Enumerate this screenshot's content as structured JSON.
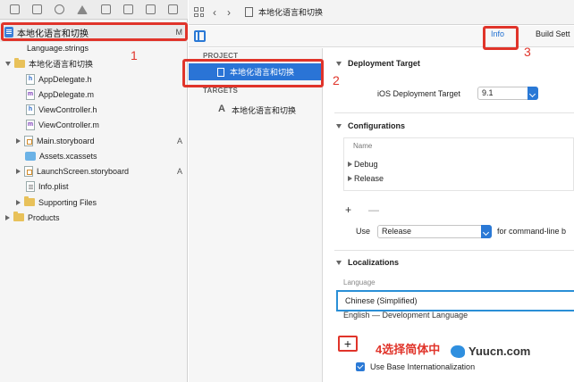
{
  "navigator": {
    "root": {
      "label": "本地化语言和切换",
      "badge": "M"
    },
    "items": [
      {
        "label": "Language.strings",
        "badge": "",
        "kind": "strings"
      },
      {
        "label": "本地化语言和切换",
        "badge": "",
        "kind": "folder-open"
      },
      {
        "label": "AppDelegate.h",
        "badge": "",
        "kind": "header"
      },
      {
        "label": "AppDelegate.m",
        "badge": "",
        "kind": "impl"
      },
      {
        "label": "ViewController.h",
        "badge": "",
        "kind": "header"
      },
      {
        "label": "ViewController.m",
        "badge": "",
        "kind": "impl"
      },
      {
        "label": "Main.storyboard",
        "badge": "A",
        "kind": "storyboard"
      },
      {
        "label": "Assets.xcassets",
        "badge": "",
        "kind": "assets"
      },
      {
        "label": "LaunchScreen.storyboard",
        "badge": "A",
        "kind": "storyboard"
      },
      {
        "label": "Info.plist",
        "badge": "",
        "kind": "plist"
      },
      {
        "label": "Supporting Files",
        "badge": "",
        "kind": "folder"
      },
      {
        "label": "Products",
        "badge": "",
        "kind": "folder"
      }
    ]
  },
  "jumpbar": {
    "crumb": "本地化语言和切换"
  },
  "tabs": {
    "info": "Info",
    "build": "Build Sett"
  },
  "project_list": {
    "project_header": "PROJECT",
    "project_item": "本地化语言和切换",
    "targets_header": "TARGETS",
    "target_item": "本地化语言和切换"
  },
  "settings": {
    "deployment": {
      "header": "Deployment Target",
      "ios_label": "iOS Deployment Target",
      "ios_value": "9.1"
    },
    "configurations": {
      "header": "Configurations",
      "name_header": "Name",
      "rows": [
        "Debug",
        "Release"
      ],
      "plus": "+",
      "minus": "—",
      "use_label": "Use",
      "use_value": "Release",
      "cmdline": "for command-line b"
    },
    "localizations": {
      "header": "Localizations",
      "language_header": "Language",
      "row1": "Chinese (Simplified)",
      "row2": "English — Development Language",
      "add": "+",
      "base_label": "Use Base Internationalization"
    }
  },
  "annotations": {
    "n1": "1",
    "n2": "2",
    "n3": "3",
    "n4": "4选择简体中"
  },
  "watermark": {
    "text": "Yuucn.com"
  },
  "colors": {
    "accent": "#2a79d6",
    "annotation": "#e0342a"
  }
}
